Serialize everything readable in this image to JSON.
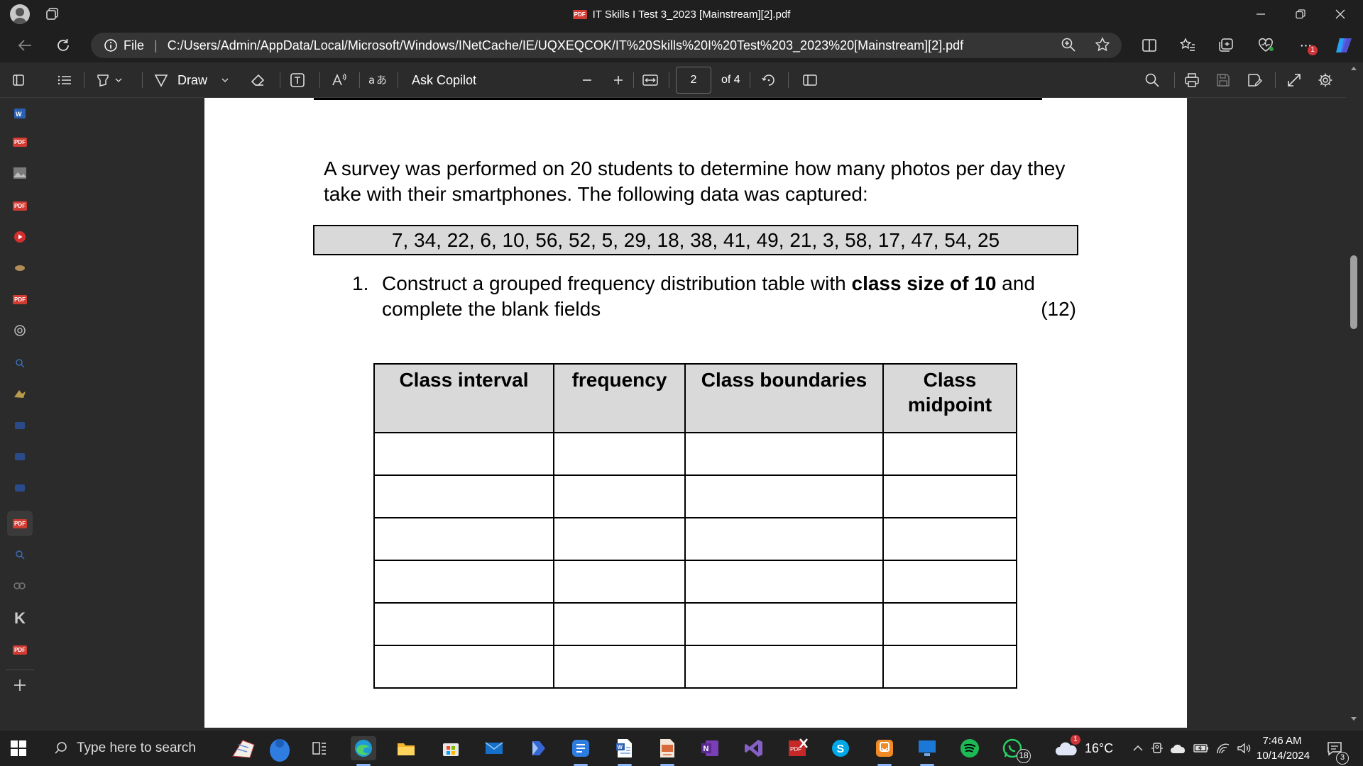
{
  "window": {
    "title": "IT Skills I Test 3_2023 [Mainstream][2].pdf",
    "title_badge": "PDF"
  },
  "address": {
    "scheme_label": "File",
    "url": "C:/Users/Admin/AppData/Local/Microsoft/Windows/INetCache/IE/UQXEQCOK/IT%20Skills%20I%20Test%203_2023%20[Mainstream][2].pdf",
    "notification_count": "1"
  },
  "pdf_toolbar": {
    "draw_label": "Draw",
    "ask_copilot_label": "Ask Copilot",
    "current_page": "2",
    "page_total": "of 4"
  },
  "document": {
    "intro": "A survey was performed on 20 students to determine how many photos per day they take with their smartphones.  The following data was captured:",
    "data_values": "7, 34, 22, 6, 10, 56, 52, 5, 29, 18, 38, 41, 49, 21, 3, 58, 17, 47, 54, 25",
    "question": {
      "number": "1.",
      "text_before": "Construct a grouped frequency distribution table with ",
      "text_bold": "class size of 10",
      "text_after": " and complete the blank fields",
      "marks": "(12)"
    },
    "table": {
      "headers": [
        "Class interval",
        "frequency",
        "Class boundaries",
        "Class midpoint"
      ],
      "rows": 6
    }
  },
  "taskbar": {
    "search_placeholder": "Type here to search",
    "whatsapp_badge": "18",
    "weather_badge": "1",
    "temperature": "16°C",
    "time": "7:46 AM",
    "date": "10/14/2024",
    "notification_count": "3"
  },
  "icons": {
    "sidebar": [
      "word-icon",
      "pdf-icon",
      "image-icon",
      "pdf-icon",
      "youtube-icon",
      "app-icon",
      "pdf-icon",
      "openai-icon",
      "search-icon",
      "app-icon",
      "blue-app-icon",
      "blue-app-icon",
      "blue-app-icon",
      "pdf-icon",
      "search-icon",
      "copilot-icon",
      "k-icon",
      "pdf-icon",
      "plus-icon"
    ]
  },
  "colors": {
    "accent": "#0078d4",
    "pdf_red": "#d23b32",
    "header_fill": "#d9d9d9"
  }
}
